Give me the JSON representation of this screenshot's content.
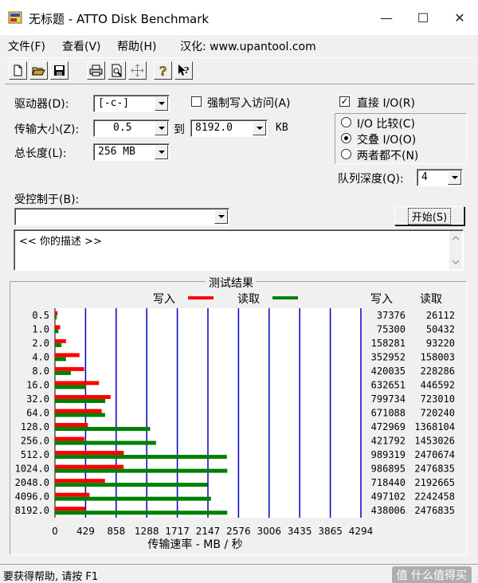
{
  "window": {
    "title": "无标题 - ATTO Disk Benchmark",
    "minimize_glyph": "—",
    "maximize_glyph": "☐",
    "close_glyph": "✕"
  },
  "menu": {
    "file": "文件(F)",
    "view": "查看(V)",
    "help": "帮助(H)",
    "credit": "汉化: www.upantool.com"
  },
  "toolbar": {
    "icons": [
      "new-file-icon",
      "open-folder-icon",
      "save-icon",
      "print-icon",
      "print-preview-icon",
      "move-icon",
      "help-icon",
      "context-help-icon"
    ]
  },
  "settings": {
    "drive_label": "驱动器(D):",
    "drive_value": "[-c-]",
    "force_write_label": "强制写入访问(A)",
    "force_write_checked": false,
    "direct_io_label": "直接 I/O(R)",
    "direct_io_checked": true,
    "transfer_size_label": "传输大小(Z):",
    "transfer_from": "0.5",
    "to_label": "到",
    "transfer_to": "8192.0",
    "unit_label": "KB",
    "total_length_label": "总长度(L):",
    "total_length_value": "256 MB",
    "io_compare_label": "I/O 比较(C)",
    "overlapped_io_label": "交叠 I/O(O)",
    "neither_label": "两者都不(N)",
    "selected_radio": "overlapped",
    "queue_depth_label": "队列深度(Q):",
    "queue_depth_value": "4",
    "controlled_by_label": "受控制于(B):",
    "controlled_by_value": "",
    "start_button_label": "开始(S)",
    "description_text": "<<   你的描述   >>"
  },
  "results": {
    "frame_title": "测试结果",
    "legend_write": "写入",
    "legend_read": "读取",
    "col_write": "写入",
    "col_read": "读取",
    "write_color": "#ff0000",
    "read_color": "#008000",
    "grid_color": "#0000c0"
  },
  "chart_data": {
    "type": "bar",
    "orientation": "horizontal",
    "categories": [
      "0.5",
      "1.0",
      "2.0",
      "4.0",
      "8.0",
      "16.0",
      "32.0",
      "64.0",
      "128.0",
      "256.0",
      "512.0",
      "1024.0",
      "2048.0",
      "4096.0",
      "8192.0"
    ],
    "series": [
      {
        "name": "写入",
        "values": [
          37376,
          75300,
          158281,
          352952,
          420035,
          632651,
          799734,
          671088,
          472969,
          421792,
          989319,
          986895,
          718440,
          497102,
          438006
        ]
      },
      {
        "name": "读取",
        "values": [
          26112,
          50432,
          93220,
          158003,
          228286,
          446592,
          723010,
          720240,
          1368104,
          1453026,
          2470674,
          2476835,
          2192665,
          2242458,
          2476835
        ]
      }
    ],
    "write_display": [
      "37376",
      "75300",
      "158281",
      "352952",
      "420035",
      "632651",
      "799734",
      "671088",
      "472969",
      "421792",
      "989319",
      "986895",
      "718440",
      "497102",
      "438006"
    ],
    "read_display": [
      "26112",
      "50432",
      "93220",
      "158003",
      "228286",
      "446592",
      "723010",
      "720240",
      "1368104",
      "1453026",
      "2470674",
      "2476835",
      "2192665",
      "2242458",
      "2476835"
    ],
    "xticks": [
      "0",
      "429",
      "858",
      "1288",
      "1717",
      "2147",
      "2576",
      "3006",
      "3435",
      "3865",
      "4294"
    ],
    "xlim": [
      0,
      4294
    ],
    "xlabel": "传输速率 - MB / 秒",
    "value_unit_note": "values in KB/s"
  },
  "status": {
    "text": "要获得帮助, 请按 F1",
    "watermark": "值 什么值得买"
  }
}
